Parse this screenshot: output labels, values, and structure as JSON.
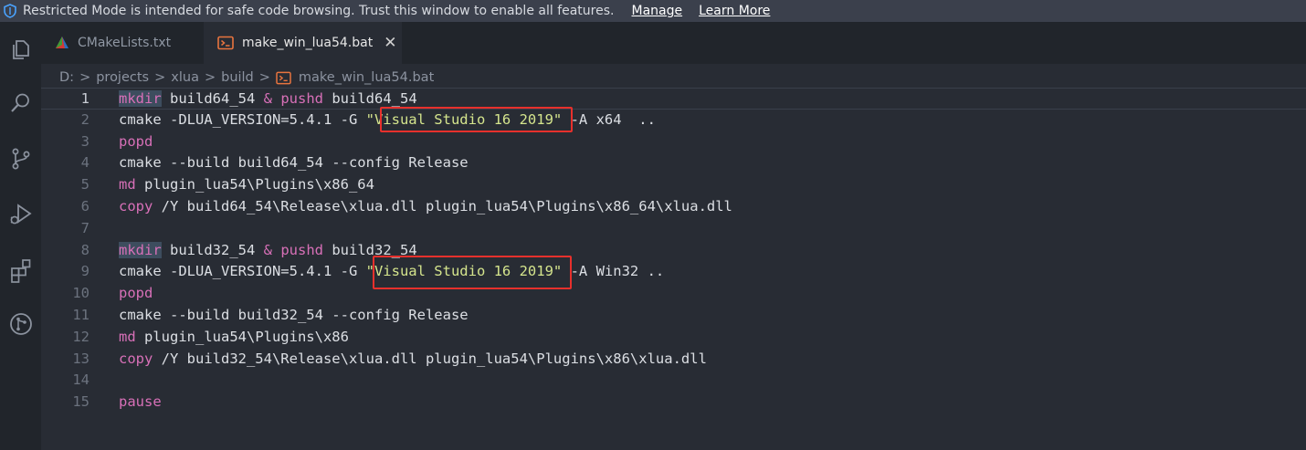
{
  "banner": {
    "message": "Restricted Mode is intended for safe code browsing. Trust this window to enable all features.",
    "manage": "Manage",
    "learn_more": "Learn More"
  },
  "activity_bar": [
    "explorer-icon",
    "search-icon",
    "source-control-icon",
    "run-debug-icon",
    "extensions-icon",
    "git-graph-icon"
  ],
  "tabs": [
    {
      "label": "CMakeLists.txt",
      "icon": "cmake-icon",
      "active": false
    },
    {
      "label": "make_win_lua54.bat",
      "icon": "bat-file-icon",
      "active": true,
      "close": "✕"
    }
  ],
  "breadcrumb": [
    "D:",
    "projects",
    "xlua",
    "build",
    "make_win_lua54.bat"
  ],
  "breadcrumb_sep": ">",
  "editor": {
    "lines": [
      {
        "n": "1",
        "tokens": [
          {
            "t": "mkdir",
            "c": "kwh"
          },
          {
            "t": " build64_54 "
          },
          {
            "t": "&",
            "c": "kw"
          },
          {
            "t": " "
          },
          {
            "t": "pushd",
            "c": "kw"
          },
          {
            "t": " build64_54"
          }
        ]
      },
      {
        "n": "2",
        "tokens": [
          {
            "t": "cmake -DLUA_VERSION=5.4.1 -G "
          },
          {
            "t": "\"Visual Studio 16 2019\"",
            "c": "str"
          },
          {
            "t": " -A x64  .."
          }
        ]
      },
      {
        "n": "3",
        "tokens": [
          {
            "t": "popd",
            "c": "kw"
          }
        ]
      },
      {
        "n": "4",
        "tokens": [
          {
            "t": "cmake --build build64_54 --config Release"
          }
        ]
      },
      {
        "n": "5",
        "tokens": [
          {
            "t": "md",
            "c": "kw"
          },
          {
            "t": " plugin_lua54\\Plugins\\x86_64"
          }
        ]
      },
      {
        "n": "6",
        "tokens": [
          {
            "t": "copy",
            "c": "kw"
          },
          {
            "t": " /Y build64_54\\Release\\xlua.dll plugin_lua54\\Plugins\\x86_64\\xlua.dll"
          }
        ]
      },
      {
        "n": "7",
        "tokens": []
      },
      {
        "n": "8",
        "tokens": [
          {
            "t": "mkdir",
            "c": "kwh"
          },
          {
            "t": " build32_54 "
          },
          {
            "t": "&",
            "c": "kw"
          },
          {
            "t": " "
          },
          {
            "t": "pushd",
            "c": "kw"
          },
          {
            "t": " build32_54"
          }
        ]
      },
      {
        "n": "9",
        "tokens": [
          {
            "t": "cmake -DLUA_VERSION=5.4.1 -G "
          },
          {
            "t": "\"Visual Studio 16 2019\"",
            "c": "str"
          },
          {
            "t": " -A Win32 .."
          }
        ]
      },
      {
        "n": "10",
        "tokens": [
          {
            "t": "popd",
            "c": "kw"
          }
        ]
      },
      {
        "n": "11",
        "tokens": [
          {
            "t": "cmake --build build32_54 --config Release"
          }
        ]
      },
      {
        "n": "12",
        "tokens": [
          {
            "t": "md",
            "c": "kw"
          },
          {
            "t": " plugin_lua54\\Plugins\\x86"
          }
        ]
      },
      {
        "n": "13",
        "tokens": [
          {
            "t": "copy",
            "c": "kw"
          },
          {
            "t": " /Y build32_54\\Release\\xlua.dll plugin_lua54\\Plugins\\x86\\xlua.dll"
          }
        ]
      },
      {
        "n": "14",
        "tokens": []
      },
      {
        "n": "15",
        "tokens": [
          {
            "t": "pause",
            "c": "kw"
          }
        ]
      }
    ],
    "active_line": 1
  },
  "annotations": {
    "highlight_color": "#e8302c",
    "highlighted_lines": [
      2,
      9
    ]
  },
  "colors": {
    "keyword": "#d870b8",
    "string": "#d5e58d",
    "text": "#dcdfe4",
    "background": "#282c34"
  }
}
